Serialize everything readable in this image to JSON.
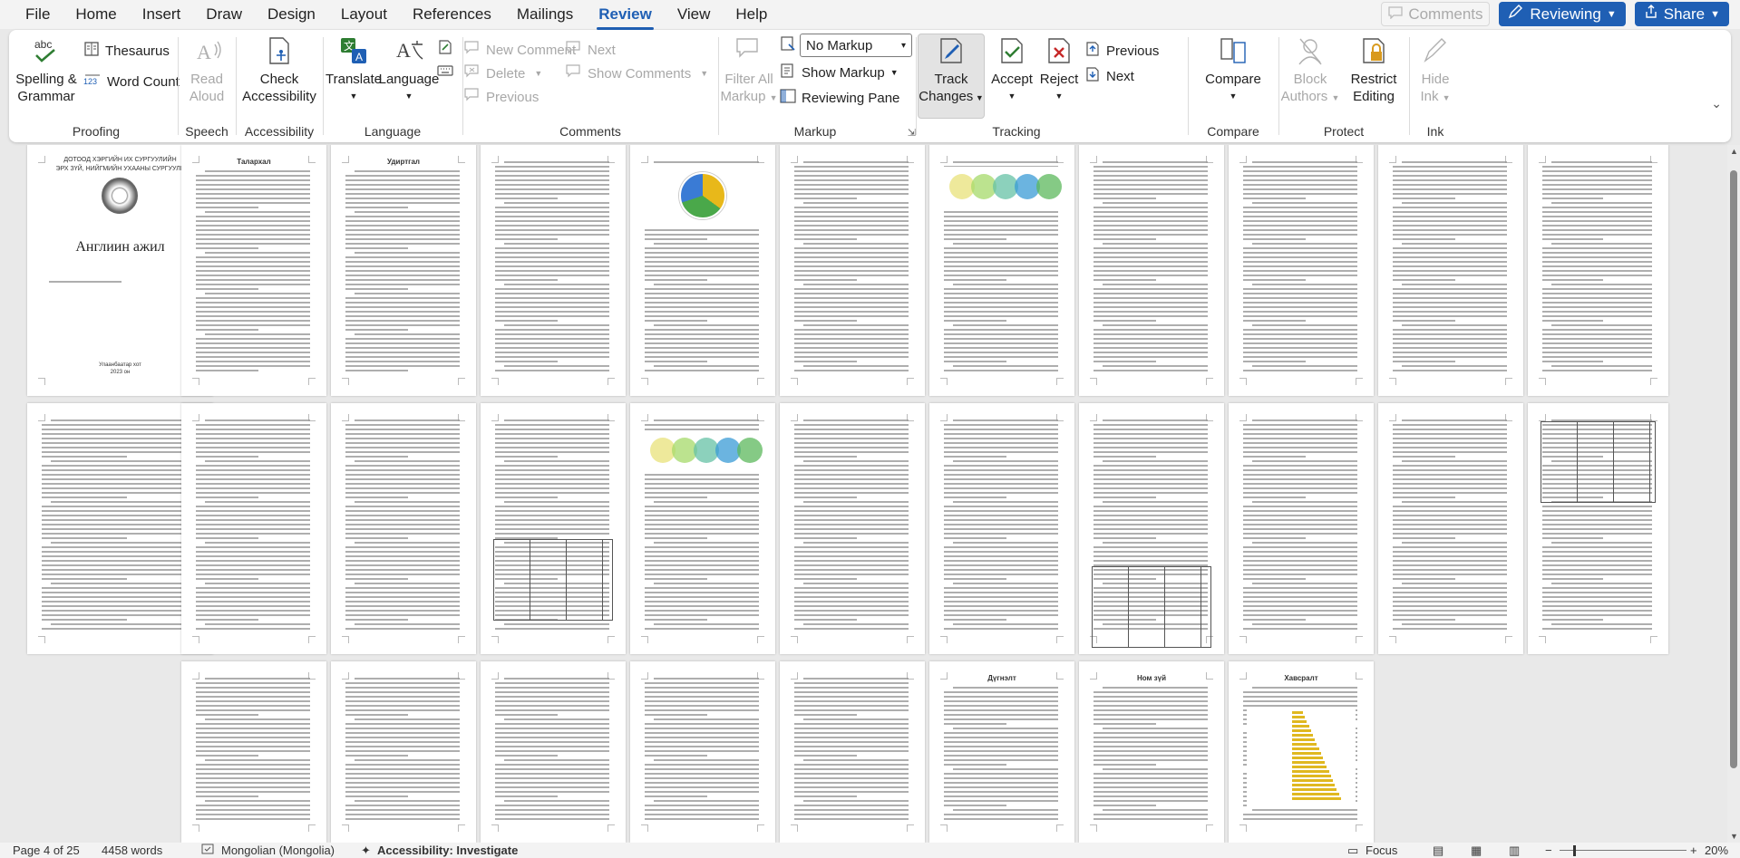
{
  "menu": {
    "tabs": [
      "File",
      "Home",
      "Insert",
      "Draw",
      "Design",
      "Layout",
      "References",
      "Mailings",
      "Review",
      "View",
      "Help"
    ],
    "active": "Review",
    "comments_label": "Comments",
    "reviewing_label": "Reviewing",
    "share_label": "Share"
  },
  "ribbon": {
    "proofing": {
      "label": "Proofing",
      "spelling": "Spelling &",
      "grammar": "Grammar",
      "thesaurus": "Thesaurus",
      "word_count": "Word Count"
    },
    "speech": {
      "label": "Speech",
      "read": "Read",
      "aloud": "Aloud"
    },
    "accessibility": {
      "label": "Accessibility",
      "check": "Check",
      "accessibility": "Accessibility"
    },
    "language": {
      "label": "Language",
      "translate": "Translate",
      "language": "Language"
    },
    "comments": {
      "label": "Comments",
      "new_comment": "New Comment",
      "delete": "Delete",
      "previous": "Previous",
      "next": "Next",
      "show_comments": "Show Comments"
    },
    "markup": {
      "label": "Markup",
      "filter_all": "Filter All",
      "markup": "Markup",
      "no_markup": "No Markup",
      "show_markup": "Show Markup",
      "reviewing_pane": "Reviewing Pane"
    },
    "tracking": {
      "label": "Tracking",
      "track": "Track",
      "changes": "Changes",
      "accept": "Accept",
      "reject": "Reject",
      "previous": "Previous",
      "next": "Next"
    },
    "compare": {
      "label": "Compare",
      "compare": "Compare"
    },
    "protect": {
      "label": "Protect",
      "block": "Block",
      "authors": "Authors",
      "restrict": "Restrict",
      "editing": "Editing"
    },
    "ink": {
      "label": "Ink",
      "hide": "Hide",
      "ink": "Ink"
    }
  },
  "document": {
    "title_page": {
      "header1": "ДОТООД ХЭРГИЙН ИХ СУРГУУЛИЙН",
      "header2": "ЭРХ ЗҮЙ, НИЙГМИЙН УХААНЫ СУРГУУЛЬ",
      "title": "Англиин ажил",
      "city": "Улаанбаатар хот",
      "year": "2023 он"
    },
    "headings": [
      "Талархал",
      "Удиртгал",
      "Дүгнэлт",
      "Ном зүй",
      "Хавсралт"
    ]
  },
  "status": {
    "page": "Page 4 of 25",
    "words": "4458 words",
    "language": "Mongolian (Mongolia)",
    "accessibility": "Accessibility: Investigate",
    "focus": "Focus",
    "zoom": "20%"
  },
  "colors": {
    "accent": "#1f5fb4",
    "ribbon_bg": "#ffffff",
    "chrome_bg": "#f3f3f3",
    "canvas_bg": "#e9e9e9"
  }
}
